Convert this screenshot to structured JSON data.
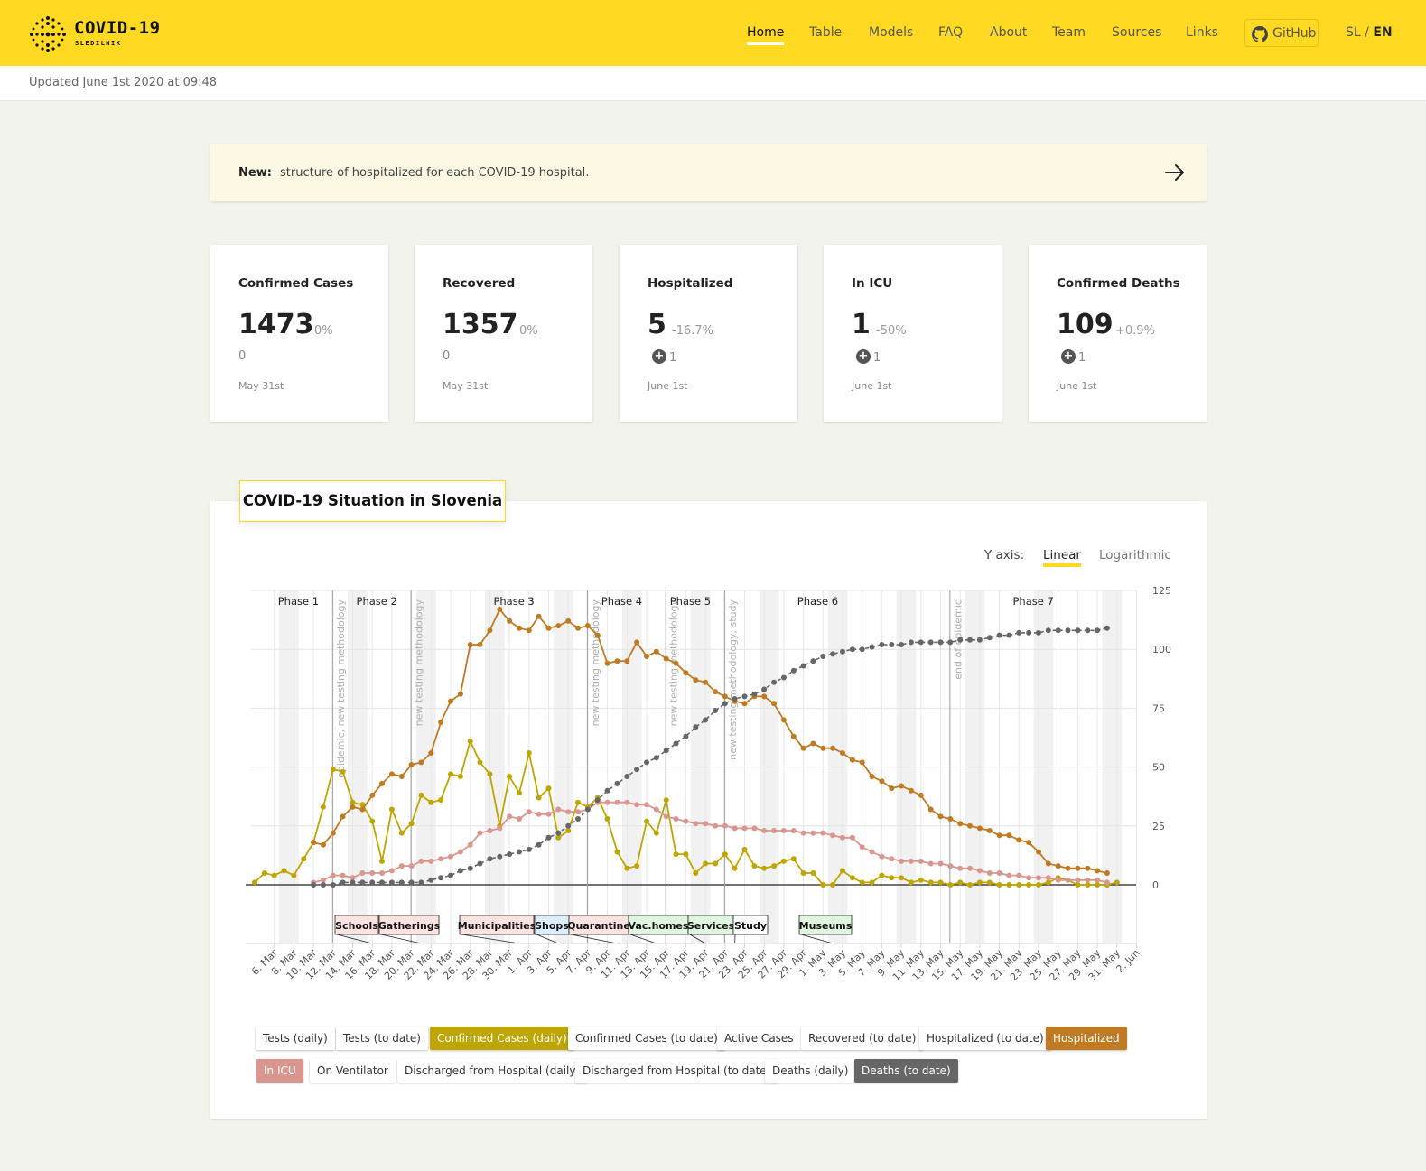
{
  "header": {
    "title": "COVID-19",
    "subtitle": "SLEDILNIK",
    "nav": [
      {
        "label": "Home",
        "active": true
      },
      {
        "label": "Table"
      },
      {
        "label": "Models"
      },
      {
        "label": "FAQ"
      },
      {
        "label": "About"
      },
      {
        "label": "Team"
      },
      {
        "label": "Sources"
      },
      {
        "label": "Links"
      }
    ],
    "github_label": "GitHub",
    "lang_sl": "SL",
    "lang_sep": " / ",
    "lang_en": "EN",
    "brand_color": "#ffd922"
  },
  "updated": "Updated June 1st 2020 at 09:48",
  "notice": {
    "label": "New:",
    "text": "structure of hospitalized for each COVID-19 hospital."
  },
  "cards": [
    {
      "title": "Confirmed Cases",
      "value": "1473",
      "pct": "0%",
      "delta": "0",
      "date": "May 31st"
    },
    {
      "title": "Recovered",
      "value": "1357",
      "pct": "0%",
      "delta": "0",
      "date": "May 31st"
    },
    {
      "title": "Hospitalized",
      "value": "5",
      "pct": "-16.7%",
      "plus": "1",
      "date": "June 1st"
    },
    {
      "title": "In ICU",
      "value": "1",
      "pct": "-50%",
      "plus": "1",
      "date": "June 1st"
    },
    {
      "title": "Confirmed Deaths",
      "value": "109",
      "pct": "+0.9%",
      "plus": "1",
      "date": "June 1st"
    }
  ],
  "chart_section": {
    "title": "COVID-19 Situation in Slovenia",
    "yaxis_label": "Y axis:",
    "yaxis_linear": "Linear",
    "yaxis_log": "Logarithmic",
    "yaxis_selected": "Linear"
  },
  "chart_data": {
    "type": "line",
    "ylim": [
      0,
      125
    ],
    "y_ticks": [
      "125",
      "100",
      "75",
      "50",
      "25",
      "0"
    ],
    "x_start": "2020-03-04",
    "x_tick_labels": [
      "6. Mar",
      "8. Mar",
      "10. Mar",
      "12. Mar",
      "14. Mar",
      "16. Mar",
      "18. Mar",
      "20. Mar",
      "22. Mar",
      "24. Mar",
      "26. Mar",
      "28. Mar",
      "30. Mar",
      "1. Apr",
      "3. Apr",
      "5. Apr",
      "7. Apr",
      "9. Apr",
      "11. Apr",
      "13. Apr",
      "15. Apr",
      "17. Apr",
      "19. Apr",
      "21. Apr",
      "23. Apr",
      "25. Apr",
      "27. Apr",
      "29. Apr",
      "1. May",
      "3. May",
      "5. May",
      "7. May",
      "9. May",
      "11. May",
      "13. May",
      "15. May",
      "17. May",
      "19. May",
      "21. May",
      "23. May",
      "25. May",
      "27. May",
      "29. May",
      "31. May",
      "2. Jun"
    ],
    "phases": [
      {
        "label": "Phase 1",
        "center": "2020-03-08"
      },
      {
        "label": "Phase 2",
        "center": "2020-03-16"
      },
      {
        "label": "Phase 3",
        "center": "2020-03-30"
      },
      {
        "label": "Phase 4",
        "center": "2020-04-10"
      },
      {
        "label": "Phase 5",
        "center": "2020-04-17"
      },
      {
        "label": "Phase 6",
        "center": "2020-04-30"
      },
      {
        "label": "Phase 7",
        "center": "2020-05-22"
      }
    ],
    "phase_boundaries": [
      "2020-03-12",
      "2020-03-20",
      "2020-04-07",
      "2020-04-15",
      "2020-04-21",
      "2020-05-14"
    ],
    "annotations": [
      {
        "date": "2020-03-12",
        "text": "epidemic, new testing methodology"
      },
      {
        "date": "2020-03-20",
        "text": "new testing methodology"
      },
      {
        "date": "2020-04-07",
        "text": "new testing methodology"
      },
      {
        "date": "2020-04-15",
        "text": "new testing methodology"
      },
      {
        "date": "2020-04-21",
        "text": "new testing methodology, study"
      },
      {
        "date": "2020-05-14",
        "text": "end of epidemic"
      }
    ],
    "events": [
      {
        "label": "Schools",
        "color": "#fde2e2"
      },
      {
        "label": "Gatherings",
        "color": "#fde2e2"
      },
      {
        "label": "Municipalities",
        "color": "#fde2e2"
      },
      {
        "label": "Shops",
        "color": "#dceefe"
      },
      {
        "label": "Quarantine",
        "color": "#fde2e2"
      },
      {
        "label": "Vac.homes",
        "color": "#e0f5e0"
      },
      {
        "label": "Services",
        "color": "#e0f5e0"
      },
      {
        "label": "Study",
        "color": "#ffffff"
      },
      {
        "label": "Museums",
        "color": "#e0f5e0"
      }
    ],
    "series": [
      {
        "name": "Confirmed Cases (daily)",
        "color": "#bfa500",
        "start": "2020-03-04",
        "values": [
          1,
          5,
          4,
          6,
          4,
          11,
          18,
          33,
          49,
          48,
          35,
          34,
          27,
          10,
          32,
          22,
          26,
          38,
          35,
          36,
          47,
          46,
          61,
          52,
          47,
          25,
          46,
          39,
          56,
          37,
          41,
          20,
          23,
          35,
          33,
          37,
          28,
          14,
          7,
          8,
          27,
          22,
          36,
          13,
          13,
          5,
          9,
          9,
          13,
          7,
          15,
          8,
          7,
          8,
          10,
          11,
          5,
          5,
          0,
          0,
          6,
          3,
          1,
          1,
          4,
          3,
          3,
          1,
          2,
          1,
          1,
          0,
          1,
          0,
          1,
          1,
          0,
          0,
          0,
          0,
          0,
          1,
          3,
          2,
          0,
          0,
          0,
          0,
          1
        ]
      },
      {
        "name": "Hospitalized",
        "color": "#c07a22",
        "start": "2020-03-10",
        "values": [
          18,
          17,
          22,
          29,
          33,
          32,
          38,
          43,
          47,
          46,
          51,
          52,
          56,
          69,
          78,
          81,
          102,
          102,
          108,
          117,
          112,
          109,
          108,
          114,
          109,
          110,
          112,
          109,
          110,
          106,
          94,
          95,
          95,
          103,
          97,
          99,
          96,
          94,
          90,
          87,
          86,
          82,
          80,
          78,
          77,
          80,
          80,
          77,
          70,
          63,
          58,
          60,
          58,
          58,
          56,
          53,
          52,
          46,
          44,
          41,
          42,
          40,
          38,
          32,
          29,
          28,
          26,
          25,
          24,
          23,
          21,
          21,
          19,
          18,
          14,
          9,
          8,
          7,
          7,
          7,
          6,
          5
        ]
      },
      {
        "name": "In ICU",
        "color": "#d9968f",
        "start": "2020-03-10",
        "values": [
          1,
          2,
          4,
          4,
          3,
          5,
          5,
          5,
          6,
          8,
          8,
          10,
          10,
          11,
          12,
          14,
          17,
          22,
          23,
          24,
          29,
          28,
          31,
          30,
          30,
          32,
          31,
          31,
          32,
          35,
          35,
          35,
          35,
          34,
          34,
          32,
          29,
          28,
          27,
          26,
          26,
          25,
          25,
          24,
          24,
          24,
          23,
          23,
          23,
          23,
          22,
          22,
          22,
          21,
          20,
          20,
          16,
          14,
          12,
          11,
          10,
          10,
          10,
          9,
          9,
          8,
          7,
          7,
          6,
          5,
          5,
          4,
          4,
          3,
          3,
          3,
          2,
          2,
          2,
          2,
          2,
          1
        ]
      },
      {
        "name": "Deaths (to date)",
        "color": "#666666",
        "dashed": true,
        "start": "2020-03-10",
        "values": [
          0,
          0,
          0,
          1,
          1,
          1,
          1,
          1,
          1,
          1,
          1,
          1,
          2,
          3,
          4,
          6,
          7,
          9,
          11,
          12,
          13,
          14,
          15,
          17,
          20,
          22,
          25,
          28,
          32,
          36,
          40,
          43,
          46,
          49,
          52,
          54,
          57,
          60,
          63,
          67,
          70,
          74,
          77,
          79,
          80,
          81,
          83,
          86,
          88,
          91,
          93,
          95,
          97,
          98,
          99,
          100,
          100,
          101,
          102,
          102,
          102,
          103,
          103,
          103,
          103,
          103,
          104,
          104,
          104,
          105,
          106,
          106,
          107,
          107,
          107,
          108,
          108,
          108,
          108,
          108,
          108,
          109
        ]
      }
    ]
  },
  "legend": [
    {
      "label": "Tests (daily)",
      "on": false
    },
    {
      "label": "Tests (to date)",
      "on": false
    },
    {
      "label": "Confirmed Cases (daily)",
      "on": true,
      "color": "#bfa500"
    },
    {
      "label": "Confirmed Cases (to date)",
      "on": false
    },
    {
      "label": "Active Cases",
      "on": false
    },
    {
      "label": "Recovered (to date)",
      "on": false
    },
    {
      "label": "Hospitalized (to date)",
      "on": false
    },
    {
      "label": "Hospitalized",
      "on": true,
      "color": "#c07a22"
    },
    {
      "label": "In ICU",
      "on": true,
      "color": "#d9968f"
    },
    {
      "label": "On Ventilator",
      "on": false
    },
    {
      "label": "Discharged from Hospital (daily)",
      "on": false
    },
    {
      "label": "Discharged from Hospital (to date)",
      "on": false
    },
    {
      "label": "Deaths (daily)",
      "on": false
    },
    {
      "label": "Deaths (to date)",
      "on": true,
      "color": "#666666"
    }
  ]
}
